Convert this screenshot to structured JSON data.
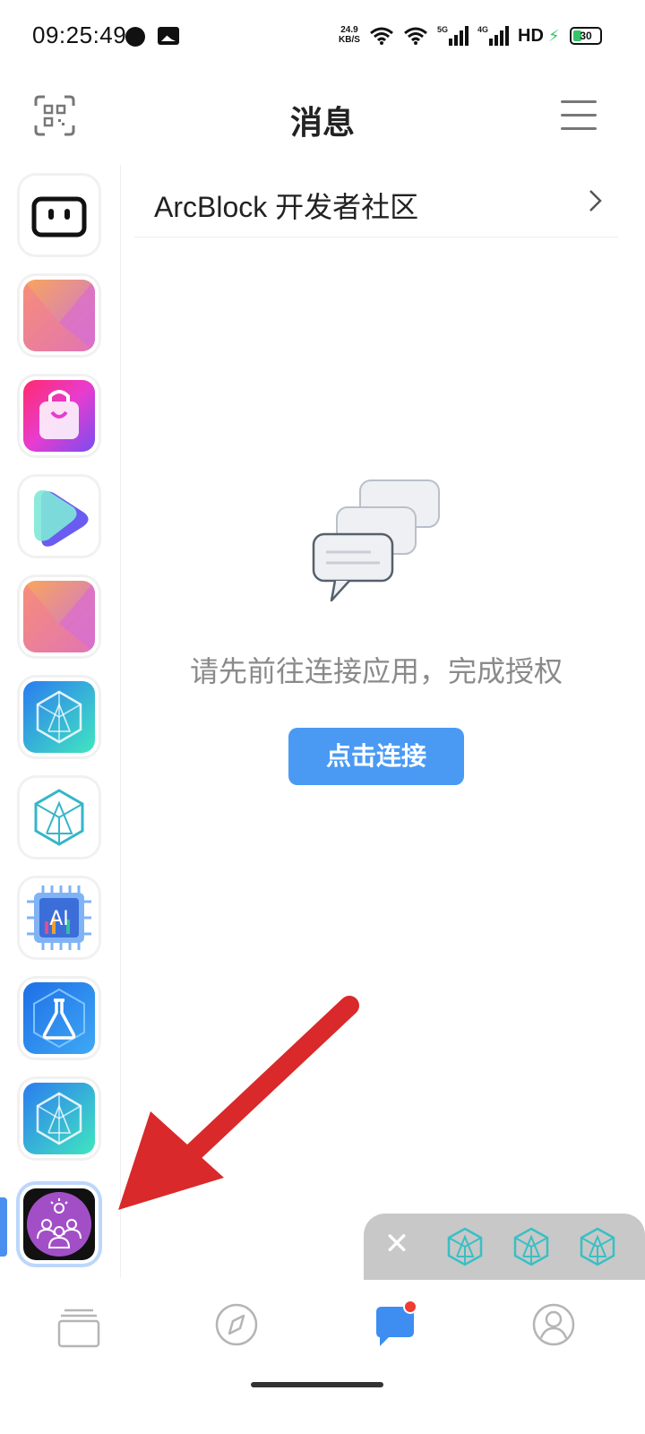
{
  "status_bar": {
    "time": "09:25:49",
    "net_rate_value": "24.9",
    "net_rate_unit": "KB/S",
    "net_5g": "5G",
    "net_4g": "4G",
    "hd": "HD",
    "battery": "30"
  },
  "header": {
    "title": "消息",
    "scan_icon": "qr-scan-icon",
    "menu_icon": "hamburger-menu-icon"
  },
  "sidebar": {
    "apps": [
      {
        "icon": "robot-face-app-icon"
      },
      {
        "icon": "gradient-envelope-app-icon"
      },
      {
        "icon": "shopping-bag-app-icon"
      },
      {
        "icon": "play-shape-app-icon"
      },
      {
        "icon": "gradient-envelope-app-icon"
      },
      {
        "icon": "arcblock-cube-app-icon"
      },
      {
        "icon": "arcblock-outline-cube-app-icon"
      },
      {
        "icon": "ai-chip-app-icon"
      },
      {
        "icon": "lab-flask-app-icon"
      },
      {
        "icon": "arcblock-cube-app-icon"
      },
      {
        "icon": "community-people-app-icon"
      }
    ],
    "selected_index": 10
  },
  "main": {
    "community_name": "ArcBlock 开发者社区",
    "empty_message": "请先前往连接应用，完成授权",
    "connect_button": "点击连接",
    "empty_icon": "chat-bubbles-icon"
  },
  "floating_bar": {
    "close_icon": "close-icon",
    "items": [
      "arcblock-cube-icon",
      "arcblock-cube-icon",
      "arcblock-cube-icon"
    ]
  },
  "bottom_nav": {
    "items": [
      {
        "icon": "cards-stack-icon"
      },
      {
        "icon": "compass-icon"
      },
      {
        "icon": "message-bubble-icon",
        "active": true,
        "badge": true
      },
      {
        "icon": "user-profile-icon"
      }
    ]
  },
  "colors": {
    "accent": "#4a9af4",
    "annotation_arrow": "#d9292a"
  }
}
